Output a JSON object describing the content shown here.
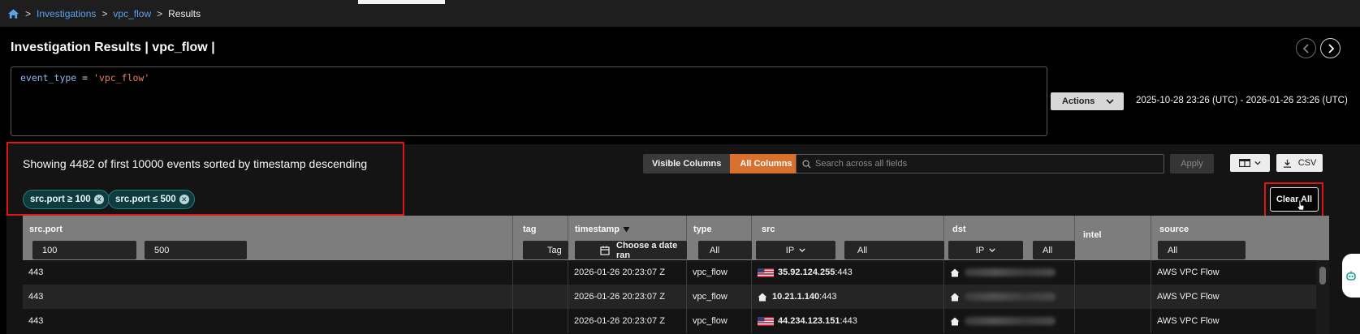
{
  "breadcrumb": {
    "items": [
      "Investigations",
      "vpc_flow"
    ],
    "current": "Results",
    "separator": ">"
  },
  "page": {
    "title": "Investigation Results | vpc_flow |"
  },
  "query": {
    "key": "event_type",
    "operator": " = ",
    "value": "'vpc_flow'"
  },
  "actions": {
    "label": "Actions",
    "date_range": "2025-10-28 23:26 (UTC) - 2026-01-26 23:26 (UTC)"
  },
  "results": {
    "summary": "Showing 4482 of first 10000 events sorted by timestamp descending",
    "filters": [
      {
        "label": "src.port ≥ 100"
      },
      {
        "label": "src.port ≤ 500"
      }
    ],
    "columns_toggle": {
      "visible": "Visible Columns",
      "all": "All Columns"
    },
    "search_placeholder": "Search across all fields",
    "apply_label": "Apply",
    "csv_label": "CSV",
    "clear_all_label": "Clear All"
  },
  "table": {
    "headers": {
      "src_port": "src.port",
      "tag": "tag",
      "timestamp": "timestamp",
      "type": "type",
      "src": "src",
      "dst": "dst",
      "intel": "intel",
      "source": "source"
    },
    "filters": {
      "src_port_min": "100",
      "src_port_max": "500",
      "tag": "Tag",
      "timestamp": "Choose a date ran",
      "type": "All",
      "src_mode": "IP",
      "src_value": "All",
      "dst_mode": "IP",
      "dst_value": "All",
      "source": "All"
    },
    "rows": [
      {
        "src_port": "443",
        "timestamp": "2026-01-26 20:23:07 Z",
        "type": "vpc_flow",
        "src_ip": "35.92.124.255",
        "src_port_suffix": ":443",
        "src_flag": "us-flag-icon",
        "source": "AWS VPC Flow"
      },
      {
        "src_port": "443",
        "timestamp": "2026-01-26 20:23:07 Z",
        "type": "vpc_flow",
        "src_ip": "10.21.1.140",
        "src_port_suffix": ":443",
        "src_flag": "home-icon",
        "source": "AWS VPC Flow"
      },
      {
        "src_port": "443",
        "timestamp": "2026-01-26 20:23:07 Z",
        "type": "vpc_flow",
        "src_ip": "44.234.123.151",
        "src_port_suffix": ":443",
        "src_flag": "us-flag-icon",
        "source": "AWS VPC Flow"
      }
    ]
  },
  "colors": {
    "link": "#5aa2ee",
    "accent_orange": "#d9702e",
    "chip_bg": "#0f3b3e",
    "highlight_red": "#e01515",
    "header_gray": "#7d7d7d"
  }
}
